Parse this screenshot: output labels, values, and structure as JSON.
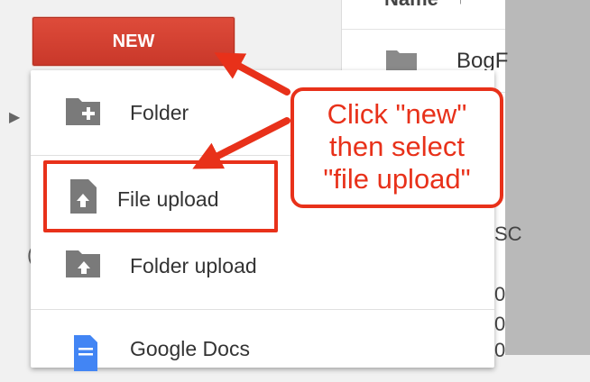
{
  "new_button": {
    "label": "NEW"
  },
  "file_list": {
    "column_header": "Name",
    "sort_indicator": "↑",
    "first_row_name": "BogF",
    "partial_rows": [
      "SC",
      "0",
      "0",
      "0"
    ]
  },
  "menu": {
    "items": [
      {
        "label": "Folder",
        "icon": "folder-plus-icon"
      },
      {
        "label": "File upload",
        "icon": "file-upload-icon"
      },
      {
        "label": "Folder upload",
        "icon": "folder-upload-icon"
      },
      {
        "label": "Google Docs",
        "icon": "google-docs-icon"
      }
    ]
  },
  "annotation": {
    "callout_lines": [
      "Click \"new\"",
      "then select",
      "\"file upload\""
    ]
  },
  "colors": {
    "accent_red": "#e8311a",
    "button_red": "#d44332",
    "docs_blue": "#4285f4",
    "icon_gray": "#7a7a7a"
  }
}
